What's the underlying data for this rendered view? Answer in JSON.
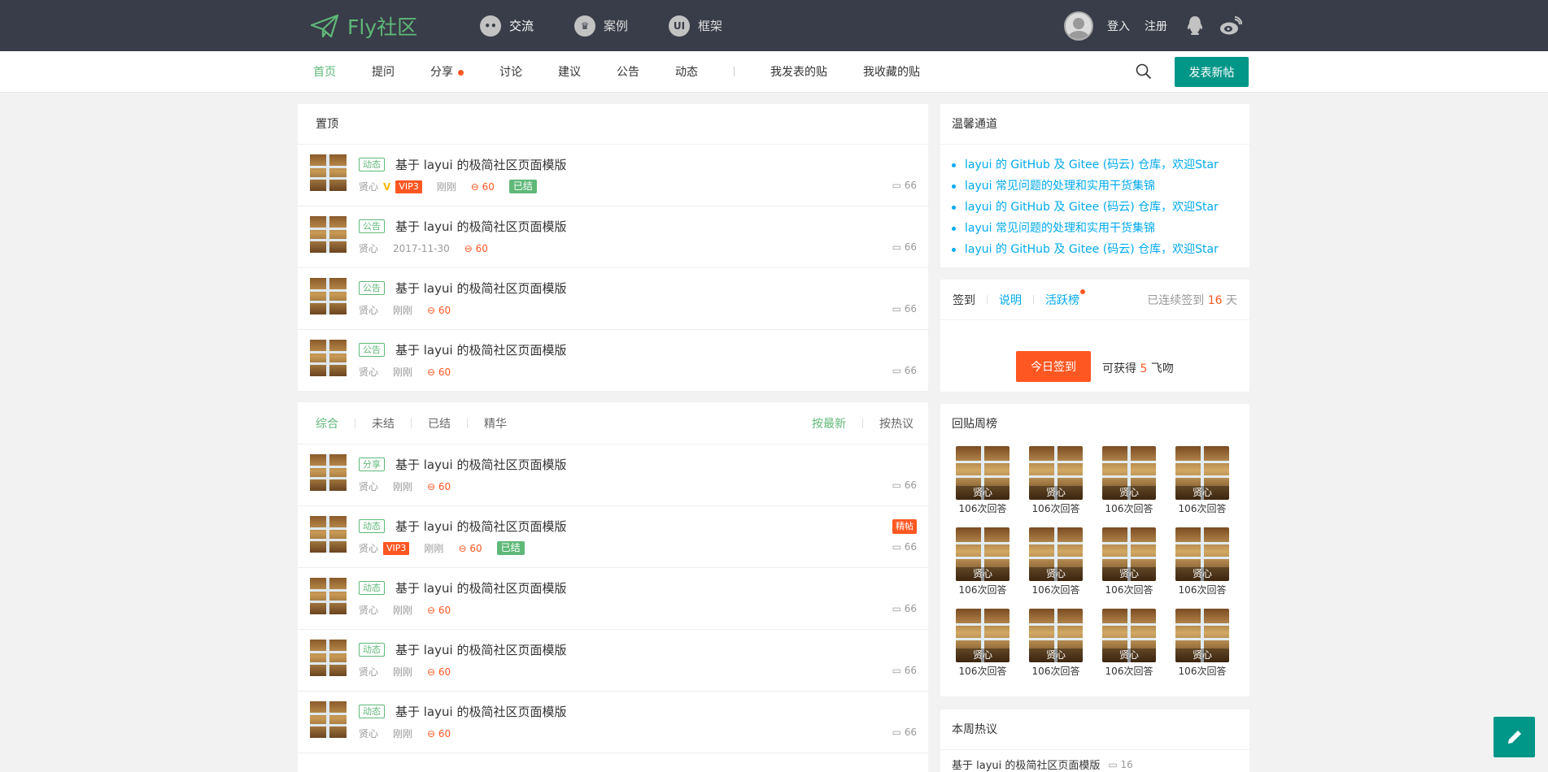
{
  "logo": {
    "text": "Fly社区"
  },
  "topnav": [
    {
      "label": "交流",
      "icon": "chat-icon"
    },
    {
      "label": "案例",
      "icon": "crown-icon"
    },
    {
      "label": "框架",
      "icon": "ui-icon"
    }
  ],
  "topright": {
    "login": "登入",
    "register": "注册"
  },
  "subnav": {
    "items": [
      "首页",
      "提问",
      "分享",
      "讨论",
      "建议",
      "公告",
      "动态"
    ],
    "my_posts": "我发表的贴",
    "my_favs": "我收藏的贴",
    "post_button": "发表新帖"
  },
  "top_panel": {
    "title": "置顶",
    "posts": [
      {
        "tag": "动态",
        "title": "基于 layui 的极简社区页面模版",
        "author": "贤心",
        "vip": "VIP3",
        "time": "刚刚",
        "views": "60",
        "solved": "已结",
        "replies": "66"
      },
      {
        "tag": "公告",
        "title": "基于 layui 的极简社区页面模版",
        "author": "贤心",
        "time": "2017-11-30",
        "views": "60",
        "replies": "66"
      },
      {
        "tag": "公告",
        "title": "基于 layui 的极简社区页面模版",
        "author": "贤心",
        "time": "刚刚",
        "views": "60",
        "replies": "66"
      },
      {
        "tag": "公告",
        "title": "基于 layui 的极简社区页面模版",
        "author": "贤心",
        "time": "刚刚",
        "views": "60",
        "replies": "66"
      }
    ]
  },
  "list_panel": {
    "filters": [
      "综合",
      "未结",
      "已结",
      "精华"
    ],
    "sorts": [
      "按最新",
      "按热议"
    ],
    "posts": [
      {
        "tag": "分享",
        "title": "基于 layui 的极简社区页面模版",
        "author": "贤心",
        "time": "刚刚",
        "views": "60",
        "replies": "66"
      },
      {
        "tag": "动态",
        "title": "基于 layui 的极简社区页面模版",
        "author": "贤心",
        "vip": "VIP3",
        "time": "刚刚",
        "views": "60",
        "solved": "已结",
        "replies": "66",
        "badge": "精帖"
      },
      {
        "tag": "动态",
        "title": "基于 layui 的极简社区页面模版",
        "author": "贤心",
        "time": "刚刚",
        "views": "60",
        "replies": "66"
      },
      {
        "tag": "动态",
        "title": "基于 layui 的极简社区页面模版",
        "author": "贤心",
        "time": "刚刚",
        "views": "60",
        "replies": "66"
      },
      {
        "tag": "动态",
        "title": "基于 layui 的极简社区页面模版",
        "author": "贤心",
        "time": "刚刚",
        "views": "60",
        "replies": "66"
      }
    ]
  },
  "warm": {
    "title": "温馨通道",
    "links": [
      "layui 的 GitHub 及 Gitee (码云) 仓库，欢迎Star",
      "layui 常见问题的处理和实用干货集锦",
      "layui 的 GitHub 及 Gitee (码云) 仓库，欢迎Star",
      "layui 常见问题的处理和实用干货集锦",
      "layui 的 GitHub 及 Gitee (码云) 仓库，欢迎Star"
    ]
  },
  "sign": {
    "tab1": "签到",
    "tab2": "说明",
    "tab3": "活跃榜",
    "days_prefix": "已连续签到",
    "days": "16",
    "days_suffix": "天",
    "button": "今日签到",
    "tip_prefix": "可获得",
    "tip_num": "5",
    "tip_suffix": "飞吻"
  },
  "rank": {
    "title": "回贴周榜",
    "users": [
      {
        "name": "贤心",
        "count": "106次回答"
      },
      {
        "name": "贤心",
        "count": "106次回答"
      },
      {
        "name": "贤心",
        "count": "106次回答"
      },
      {
        "name": "贤心",
        "count": "106次回答"
      },
      {
        "name": "贤心",
        "count": "106次回答"
      },
      {
        "name": "贤心",
        "count": "106次回答"
      },
      {
        "name": "贤心",
        "count": "106次回答"
      },
      {
        "name": "贤心",
        "count": "106次回答"
      },
      {
        "name": "贤心",
        "count": "106次回答"
      },
      {
        "name": "贤心",
        "count": "106次回答"
      },
      {
        "name": "贤心",
        "count": "106次回答"
      },
      {
        "name": "贤心",
        "count": "106次回答"
      }
    ]
  },
  "hot": {
    "title": "本周热议",
    "item": "基于 layui 的极简社区页面模版",
    "count": "16"
  },
  "colors": {
    "header": "#393d49",
    "accent": "#5fb878",
    "primary": "#009688",
    "danger": "#ff5722",
    "link": "#01aaed"
  }
}
